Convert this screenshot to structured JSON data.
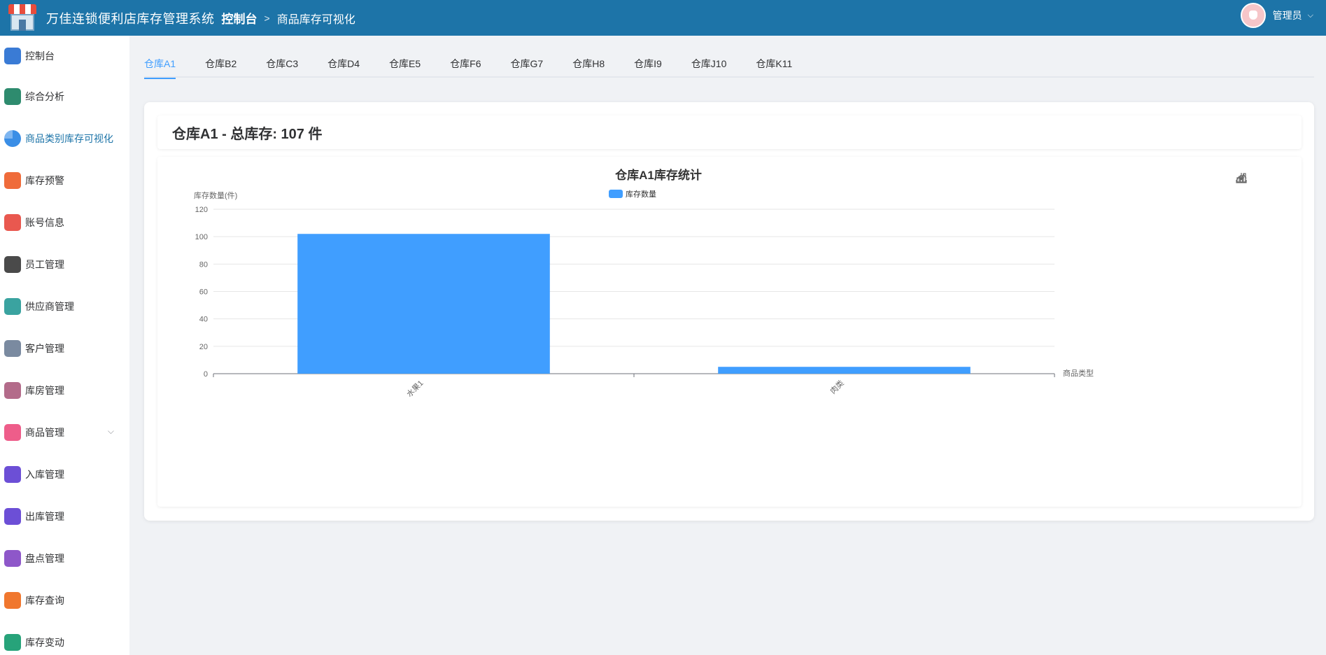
{
  "header": {
    "app_title": "万佳连锁便利店库存管理系统",
    "breadcrumb_home": "控制台",
    "breadcrumb_separator": ">",
    "breadcrumb_current": "商品库存可视化",
    "user_name": "管理员",
    "user_caret": "⌵",
    "bg_color": "#1d74a8"
  },
  "sidebar": {
    "active_color": "#1d74a8",
    "items": [
      {
        "label": "控制台",
        "icon": "dashboard-icon",
        "color": "#3a7bd5"
      },
      {
        "label": "综合分析",
        "icon": "analysis-monitor-icon",
        "color": "#2e8b6e"
      },
      {
        "label": "商品类别库存可视化",
        "icon": "pie-chart-icon",
        "color": "#3a8ee6"
      },
      {
        "label": "库存预警",
        "icon": "warning-house-icon",
        "color": "#ef6b3a"
      },
      {
        "label": "账号信息",
        "icon": "account-icon",
        "color": "#e9584f"
      },
      {
        "label": "员工管理",
        "icon": "employee-icon",
        "color": "#4a4a4a"
      },
      {
        "label": "供应商管理",
        "icon": "supplier-icon",
        "color": "#3aa3a0"
      },
      {
        "label": "客户管理",
        "icon": "customer-icon",
        "color": "#7a8aa0"
      },
      {
        "label": "库房管理",
        "icon": "warehouse-icon",
        "color": "#b36b8a"
      },
      {
        "label": "商品管理",
        "icon": "product-icon",
        "color": "#ee5d8a",
        "chevron": "⌵"
      },
      {
        "label": "入库管理",
        "icon": "inbound-icon",
        "color": "#6c4fd6"
      },
      {
        "label": "出库管理",
        "icon": "outbound-icon",
        "color": "#6c4fd6"
      },
      {
        "label": "盘点管理",
        "icon": "inventory-check-icon",
        "color": "#8e57c9"
      },
      {
        "label": "库存查询",
        "icon": "stock-query-icon",
        "color": "#f0772e"
      },
      {
        "label": "库存变动",
        "icon": "stock-change-icon",
        "color": "#27a37a"
      }
    ]
  },
  "tabs": {
    "active_index": 0,
    "accent_color": "#409eff",
    "items": [
      "仓库A1",
      "仓库B2",
      "仓库C3",
      "仓库D4",
      "仓库E5",
      "仓库F6",
      "仓库G7",
      "仓库H8",
      "仓库I9",
      "仓库J10",
      "仓库K11"
    ]
  },
  "card": {
    "header_title": "仓库A1 - 总库存: 107 件"
  },
  "chart_data": {
    "type": "bar",
    "title": "仓库A1库存统计",
    "legend": [
      "库存数量"
    ],
    "legend_position": "top-center",
    "xlabel": "商品类型",
    "ylabel": "库存数量(件)",
    "categories": [
      "水果1",
      "肉类"
    ],
    "series": [
      {
        "name": "库存数量",
        "values": [
          102,
          5
        ],
        "color": "#409eff"
      }
    ],
    "ylim": [
      0,
      120
    ],
    "yticks": [
      0,
      20,
      40,
      60,
      80,
      100,
      120
    ],
    "grid": true,
    "toolbox": [
      "line-chart-icon",
      "bar-chart-icon",
      "download-icon"
    ]
  }
}
